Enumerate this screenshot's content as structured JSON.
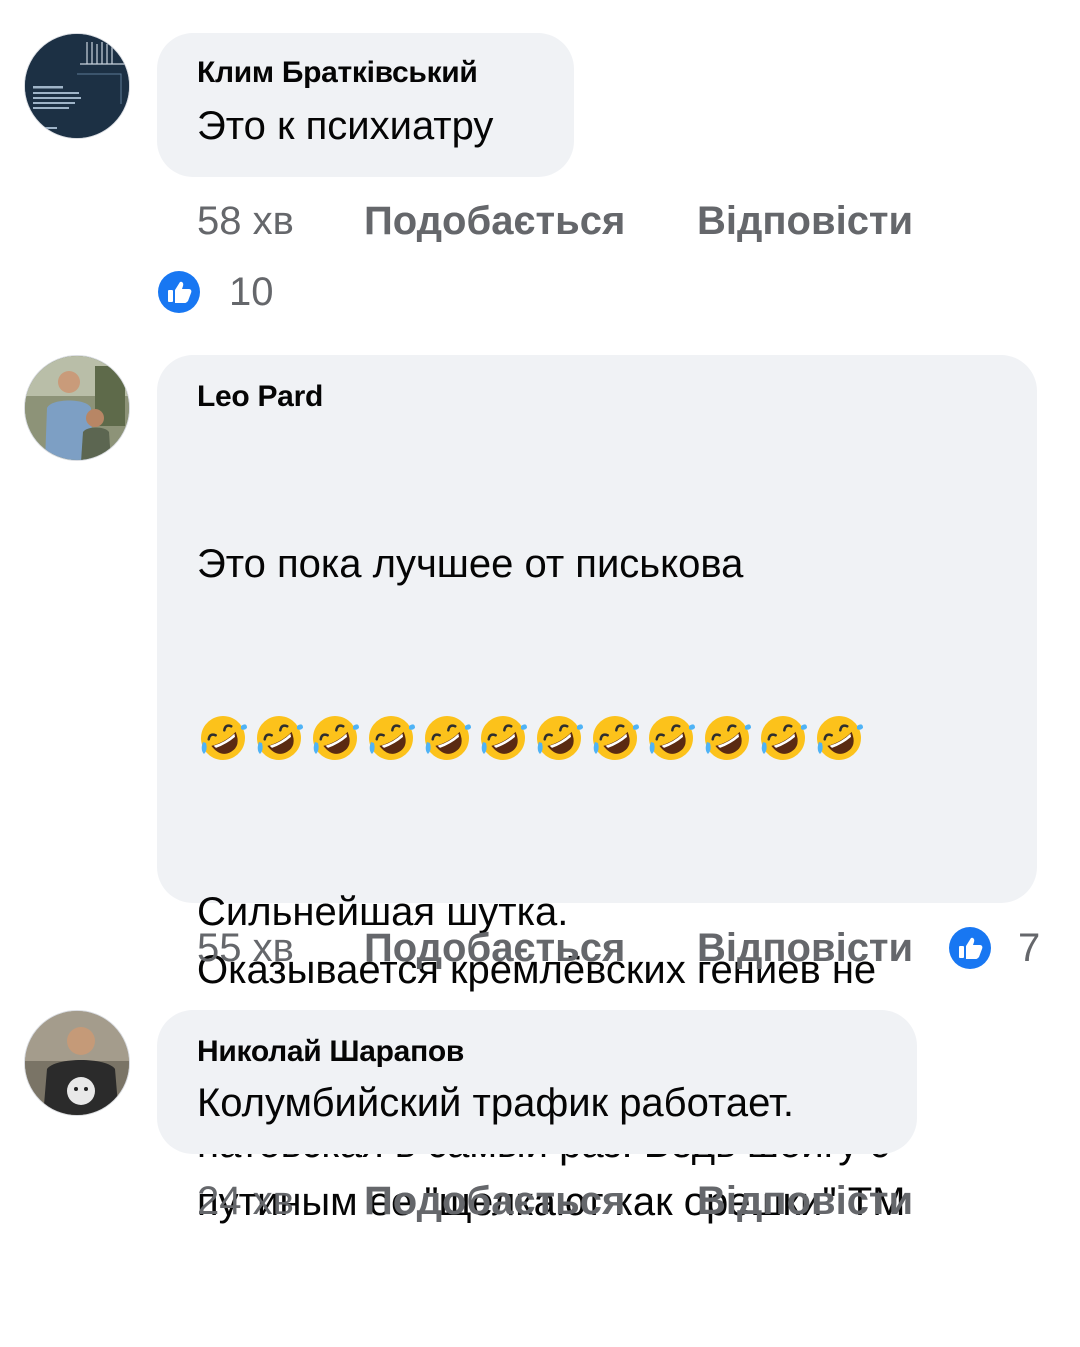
{
  "comments": [
    {
      "author": "Клим Братківський",
      "lines": [
        "Это к психиатру"
      ],
      "time": "58 хв",
      "like_label": "Подобається",
      "reply_label": "Відповісти",
      "reaction_count": "10"
    },
    {
      "author": "Leo Pard",
      "line1": "Это пока лучшее от писькова",
      "emoji_count": 12,
      "emoji": "rolling-on-floor-laughing",
      "rest": "Сильнейшая шутка.\nОказывается кремлёвских гениев не\nустраивала именення советская и\nукраинская военная техника. А вот\nнатовская в самый раз. Ведь шойгу с\nпутиным ее \"щелкают как орешки\" ТМ",
      "time": "55 хв",
      "like_label": "Подобається",
      "reply_label": "Відповісти",
      "reaction_count": "7"
    },
    {
      "author": "Николай Шарапов",
      "lines": [
        "Колумбийский трафик работает."
      ],
      "time": "24 хв",
      "like_label": "Подобається",
      "reply_label": "Відповісти"
    }
  ],
  "colors": {
    "bubble": "#f0f2f5",
    "secondary_text": "#65676b",
    "like_blue": "#1877f2"
  }
}
